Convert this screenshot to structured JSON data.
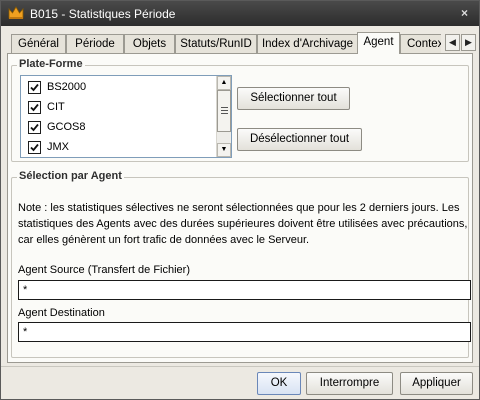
{
  "window": {
    "title": "B015 - Statistiques Période",
    "close_glyph": "×"
  },
  "tabs": [
    {
      "label": "Général"
    },
    {
      "label": "Période"
    },
    {
      "label": "Objets"
    },
    {
      "label": "Statuts/RunID"
    },
    {
      "label": "Index d'Archivage"
    },
    {
      "label": "Agent"
    },
    {
      "label": "Contexte"
    }
  ],
  "active_tab": "Agent",
  "tab_scroll": {
    "left_glyph": "◀",
    "right_glyph": "▶"
  },
  "platform_group": {
    "title": "Plate-Forme",
    "items": [
      {
        "label": "BS2000",
        "checked": true
      },
      {
        "label": "CIT",
        "checked": true
      },
      {
        "label": "GCOS8",
        "checked": true
      },
      {
        "label": "JMX",
        "checked": true
      }
    ],
    "select_all_label": "Sélectionner tout",
    "deselect_all_label": "Désélectionner tout",
    "scroll_up_glyph": "▲",
    "scroll_down_glyph": "▼"
  },
  "agent_group": {
    "title": "Sélection par Agent",
    "note": "Note : les statistiques sélectives ne seront sélectionnées que pour les 2 derniers jours. Les statistiques des Agents avec des durées supérieures doivent être utilisées avec précautions, car elles génèrent un fort trafic de données avec le Serveur.",
    "source_label": "Agent Source (Transfert de Fichier)",
    "source_value": "*",
    "destination_label": "Agent Destination",
    "destination_value": "*"
  },
  "footer": {
    "ok_label": "OK",
    "interrupt_label": "Interrompre",
    "apply_label": "Appliquer"
  },
  "colors": {
    "titlebar": "#2c2c2c",
    "accent_icon": "#f0a020",
    "panel": "#fbfbf8",
    "dialog": "#ece9e2"
  }
}
